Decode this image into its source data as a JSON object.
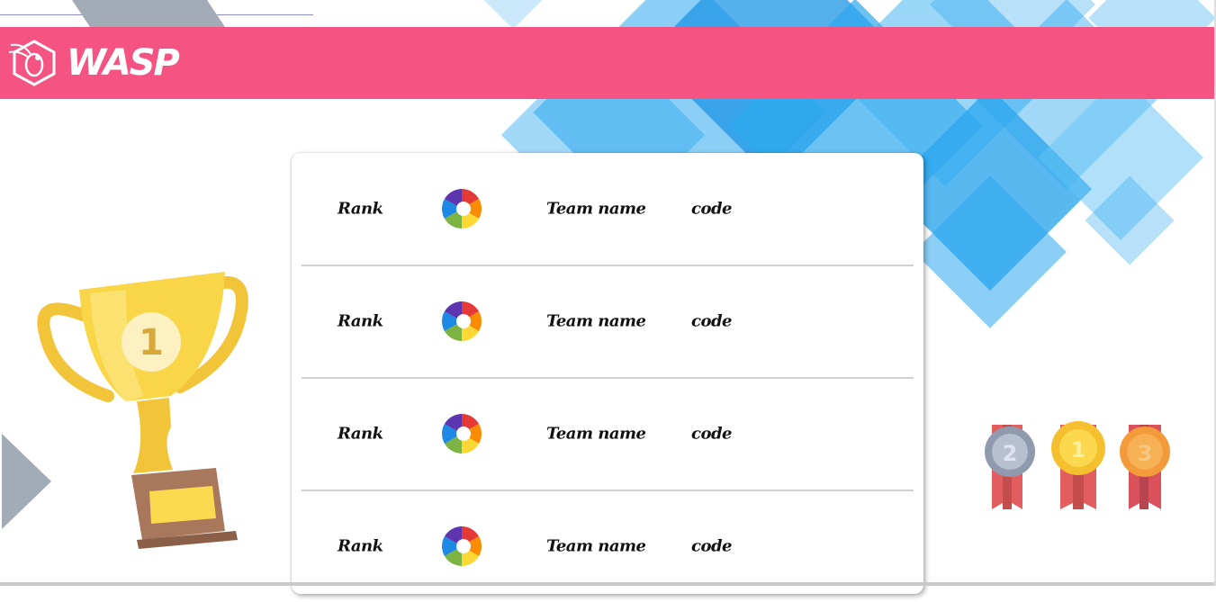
{
  "header": {
    "brand": "WASP",
    "logo_icon": "wasp-icon",
    "color": "#f55483"
  },
  "leaderboard": {
    "rows": [
      {
        "rank": "Rank",
        "team_name": "Team name",
        "code": "code",
        "icon": "team-avatar-icon"
      },
      {
        "rank": "Rank",
        "team_name": "Team name",
        "code": "code",
        "icon": "team-avatar-icon"
      },
      {
        "rank": "Rank",
        "team_name": "Team name",
        "code": "code",
        "icon": "team-avatar-icon"
      },
      {
        "rank": "Rank",
        "team_name": "Team name",
        "code": "code",
        "icon": "team-avatar-icon"
      }
    ]
  },
  "decorations": {
    "trophy": {
      "label": "1",
      "icon": "trophy-icon"
    },
    "medals": [
      {
        "label": "2",
        "icon": "silver-medal-icon"
      },
      {
        "label": "1",
        "icon": "gold-medal-icon"
      },
      {
        "label": "3",
        "icon": "bronze-medal-icon"
      }
    ]
  },
  "colors": {
    "accent_pink": "#f55483",
    "sky_blue": "#2ea8ee",
    "gold": "#f9d648",
    "slate": "#a3abb6"
  }
}
